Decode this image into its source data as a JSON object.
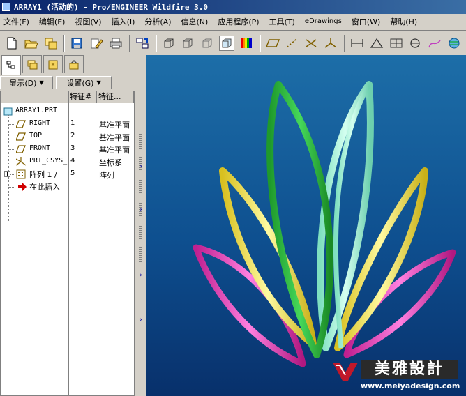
{
  "window": {
    "title": "ARRAY1 (活动的) - Pro/ENGINEER Wildfire 3.0"
  },
  "menu": [
    "文件(F)",
    "编辑(E)",
    "视图(V)",
    "插入(I)",
    "分析(A)",
    "信息(N)",
    "应用程序(P)",
    "工具(T)",
    "eDrawings",
    "窗口(W)",
    "帮助(H)"
  ],
  "toolbar": {
    "icons": [
      "new-file-icon",
      "open-folder-icon",
      "open-multiple-icon",
      "save-icon",
      "edit-icon",
      "print-icon",
      "regenerate-icon",
      "wireframe-icon",
      "hidden-line-icon",
      "no-hidden-icon",
      "shaded-icon",
      "appearance-icon",
      "datum-plane-icon",
      "datum-axis-icon",
      "datum-point-icon",
      "csys-icon",
      "measure-distance-icon",
      "measure-angle-icon",
      "section-icon",
      "mass-props-icon",
      "sketch-icon",
      "globe-icon"
    ]
  },
  "tree": {
    "tabs": [
      "model-tree-tab",
      "layer-tab",
      "favorites-tab",
      "tools-tab"
    ],
    "show_label": "显示(D)",
    "settings_label": "设置(G)",
    "col_feature_num": "特征#",
    "col_feature_type": "特征...",
    "root": "ARRAY1.PRT",
    "rows": [
      {
        "name": "RIGHT",
        "num": "1",
        "type": "基准平面",
        "icon": "datum-plane-icon"
      },
      {
        "name": "TOP",
        "num": "2",
        "type": "基准平面",
        "icon": "datum-plane-icon"
      },
      {
        "name": "FRONT",
        "num": "3",
        "type": "基准平面",
        "icon": "datum-plane-icon"
      },
      {
        "name": "PRT_CSYS_",
        "num": "4",
        "type": "坐标系",
        "icon": "csys-icon"
      },
      {
        "name": "阵列 1 /",
        "num": "5",
        "type": "阵列",
        "icon": "pattern-icon"
      },
      {
        "name": "在此插入",
        "num": "",
        "type": "",
        "icon": "insert-here-arrow-icon"
      }
    ]
  },
  "watermark": {
    "title": "美雅設計",
    "url": "www.meiyadesign.com"
  },
  "colors": {
    "green": "#2fbf3f",
    "mint": "#9ff5d8",
    "yellow": "#f5e850",
    "magenta": "#e84bc8"
  }
}
